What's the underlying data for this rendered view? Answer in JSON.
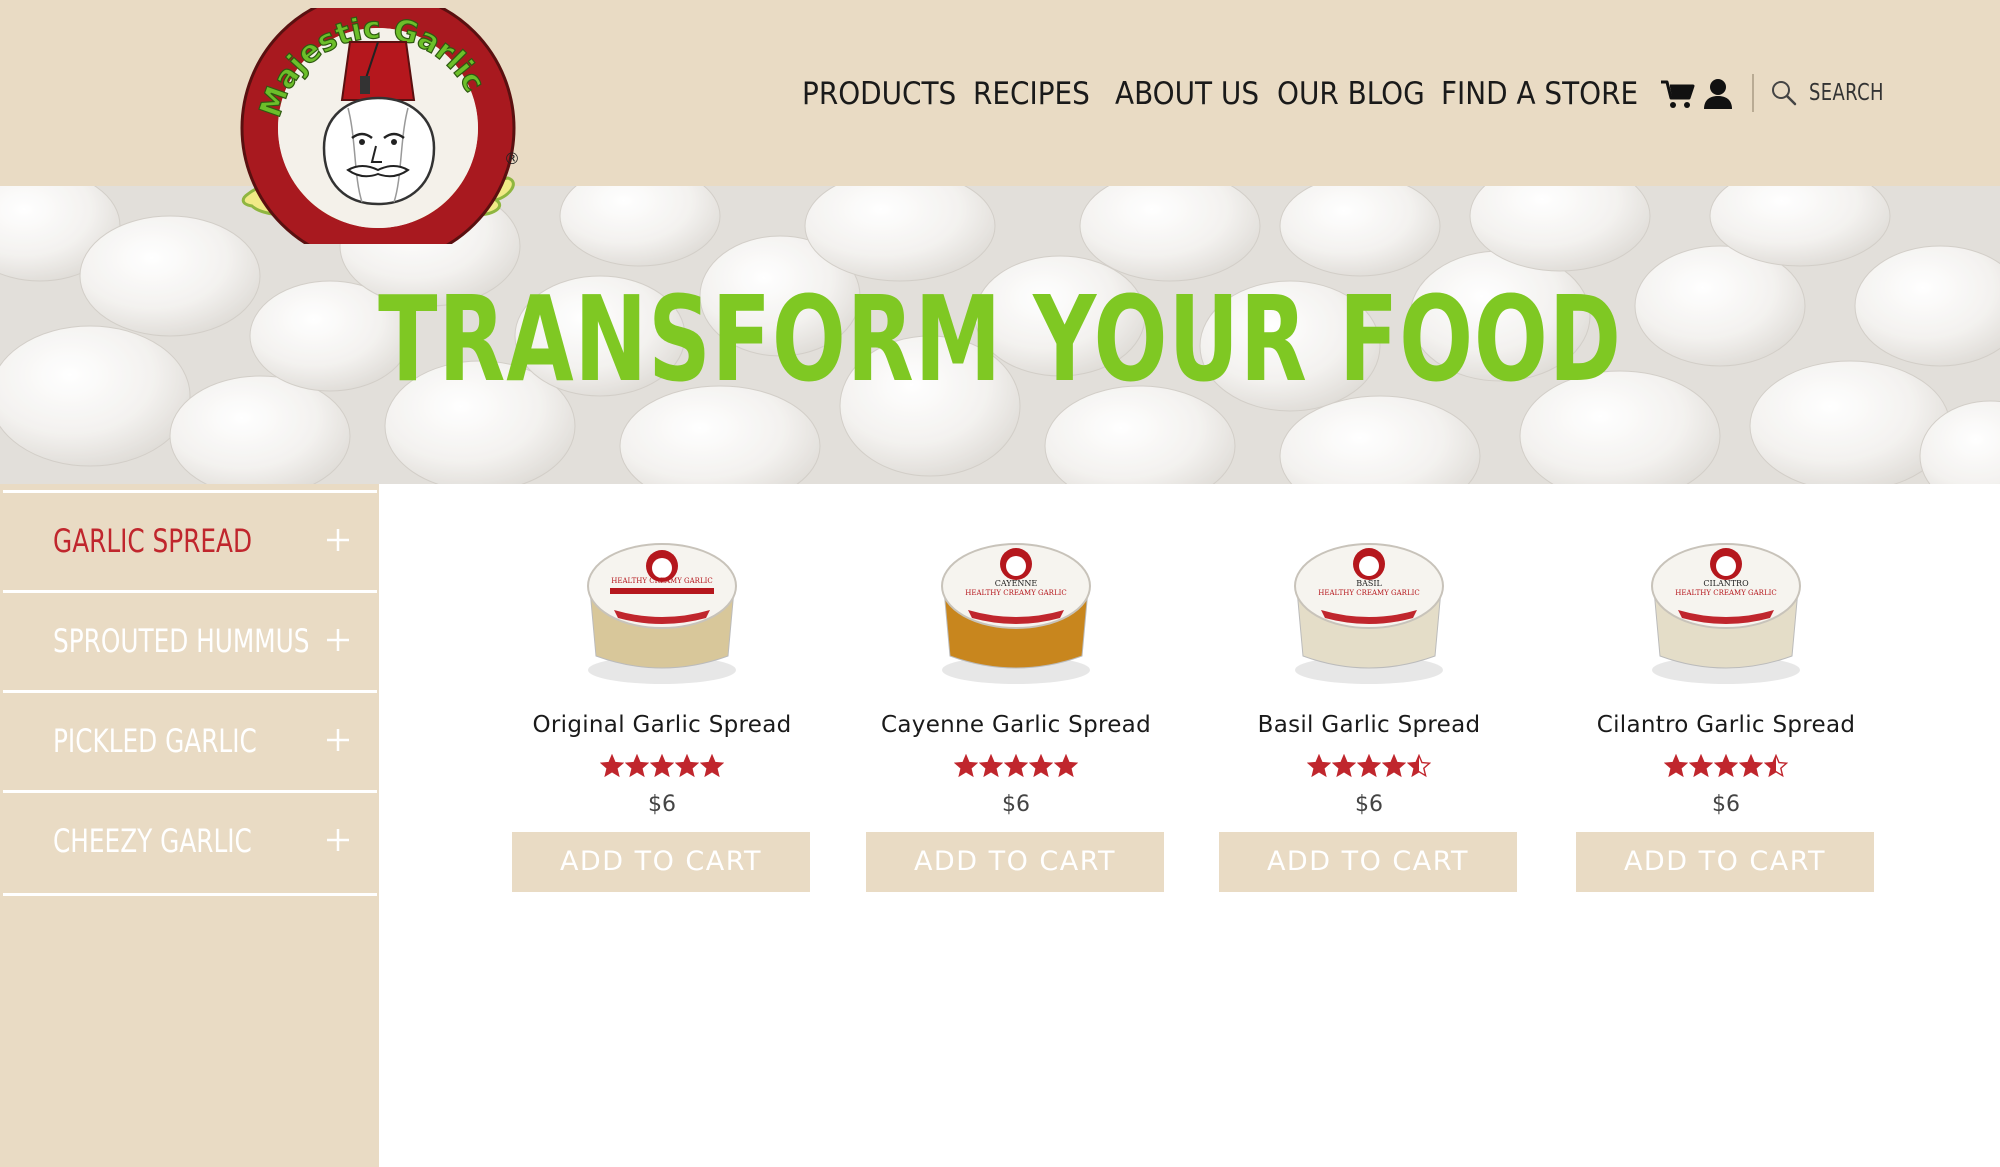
{
  "brand": {
    "logo_alt": "Majestic Garlic",
    "logo_text": "Majestic Garlic",
    "registered_mark": "®"
  },
  "nav": {
    "items": [
      {
        "label": "PRODUCTS",
        "active": true
      },
      {
        "label": "RECIPES",
        "active": false
      },
      {
        "label": "ABOUT US",
        "active": false
      },
      {
        "label": "OUR BLOG",
        "active": false
      },
      {
        "label": "FIND A STORE",
        "active": false
      }
    ],
    "search_label": "SEARCH",
    "icons": [
      "cart-icon",
      "user-icon",
      "search-icon"
    ]
  },
  "hero": {
    "title": "TRANSFORM YOUR FOOD"
  },
  "sidebar": {
    "items": [
      {
        "label": "GARLIC SPREAD",
        "active": true
      },
      {
        "label": "SPROUTED HUMMUS",
        "active": false
      },
      {
        "label": "PICKLED GARLIC",
        "active": false
      },
      {
        "label": "CHEEZY GARLIC",
        "active": false
      }
    ],
    "expand_icon": "plus-icon"
  },
  "products": [
    {
      "name": "Original Garlic Spread",
      "rating": 5,
      "price": "$6",
      "button": "ADD TO CART",
      "lid_text": "HEALTHY CREAMY GARLIC",
      "flavor": "",
      "band_color": "#d8c79a"
    },
    {
      "name": "Cayenne Garlic Spread",
      "rating": 5,
      "price": "$6",
      "button": "ADD TO CART",
      "lid_text": "HEALTHY CREAMY GARLIC",
      "flavor": "CAYENNE",
      "band_color": "#c8861e"
    },
    {
      "name": "Basil Garlic Spread",
      "rating": 4.5,
      "price": "$6",
      "button": "ADD TO CART",
      "lid_text": "HEALTHY CREAMY GARLIC",
      "flavor": "BASIL",
      "band_color": "#e4ddc8"
    },
    {
      "name": "Cilantro Garlic Spread",
      "rating": 4.5,
      "price": "$6",
      "button": "ADD TO CART",
      "lid_text": "HEALTHY CREAMY GARLIC",
      "flavor": "CILANTRO",
      "band_color": "#e4ddc8"
    }
  ],
  "colors": {
    "header_bg": "#e9dbc4",
    "accent_red": "#c0262d",
    "hero_green": "#7fc823",
    "star_red": "#c0262d"
  }
}
